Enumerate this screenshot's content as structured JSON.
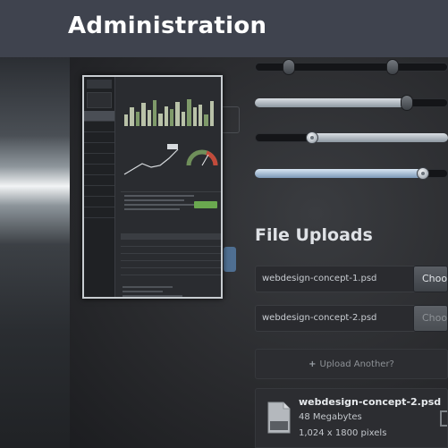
{
  "header": {
    "title": "Administration"
  },
  "uploads": {
    "title": "File Uploads",
    "fields": [
      {
        "filename": "webdesign-concept-1.psd",
        "button": "Choose",
        "enabled": true
      },
      {
        "filename": "webdesign-concept-2.psd",
        "button": "Choose",
        "enabled": false
      }
    ],
    "upload_another": "Upload Another?",
    "file_card": {
      "name": "webdesign-concept-2.psd",
      "size": "48 Megabytes",
      "dimensions": "1,024 x 1800 pixels"
    }
  },
  "sliders": [
    {
      "type": "range",
      "min": 0.0,
      "max": 0.65
    },
    {
      "type": "value",
      "value": 0.73
    },
    {
      "type": "knob",
      "value": 0.27
    },
    {
      "type": "knob",
      "value": 0.8
    }
  ],
  "icons": {
    "add": "plus-icon",
    "file": "psd-file-icon"
  }
}
